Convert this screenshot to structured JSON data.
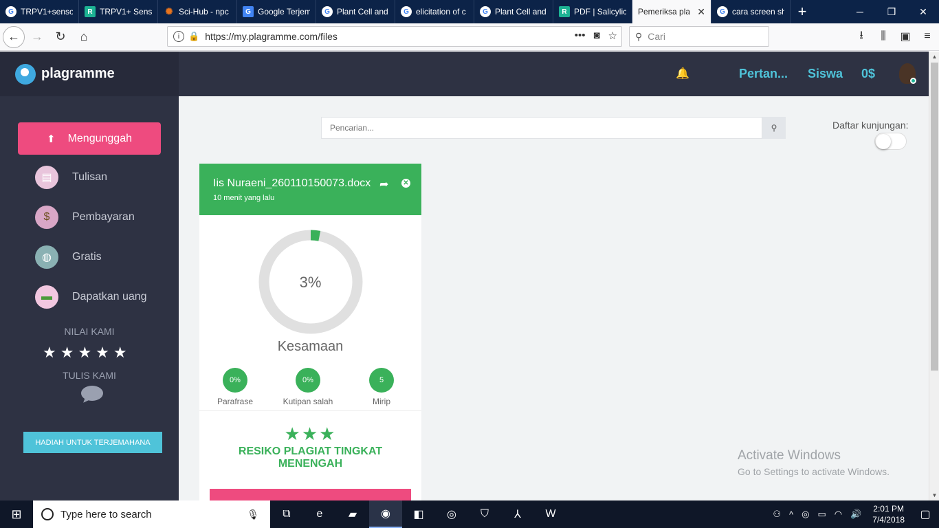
{
  "browser": {
    "tabs": [
      {
        "label": "TRPV1+senso",
        "favicon": "google"
      },
      {
        "label": "TRPV1+ Sens",
        "favicon": "researchgate"
      },
      {
        "label": "Sci-Hub - npc",
        "favicon": "scihub"
      },
      {
        "label": "Google Terjem",
        "favicon": "google-translate"
      },
      {
        "label": "Plant Cell and",
        "favicon": "google"
      },
      {
        "label": "elicitation of c",
        "favicon": "google"
      },
      {
        "label": "Plant Cell and",
        "favicon": "google"
      },
      {
        "label": "PDF | Salicylic",
        "favicon": "researchgate"
      },
      {
        "label": "Pemeriksa pla",
        "favicon": "none",
        "active": true
      },
      {
        "label": "cara screen sh",
        "favicon": "google"
      }
    ],
    "url": "https://my.plagramme.com/files",
    "search_placeholder": "Cari"
  },
  "app": {
    "logo_text": "plagramme",
    "topbar": {
      "link1": "Pertan...",
      "link2": "Siswa",
      "balance": "0$"
    },
    "sidebar": {
      "upload_label": "Mengunggah",
      "items": [
        {
          "label": "Tulisan",
          "icon": "document-icon"
        },
        {
          "label": "Pembayaran",
          "icon": "money-bag-icon"
        },
        {
          "label": "Gratis",
          "icon": "globe-dollar-icon"
        },
        {
          "label": "Dapatkan uang",
          "icon": "cash-icon"
        }
      ],
      "rate_title": "NILAI KAMI",
      "rating_stars": 5,
      "write_title": "TULIS KAMI",
      "reward_label": "HADIAH UNTUK TERJEMAHANA"
    },
    "search": {
      "placeholder": "Pencarian..."
    },
    "visits_label": "Daftar kunjungan:",
    "card": {
      "title": "Iis Nuraeni_260110150073.docx",
      "time": "10 menit yang lalu",
      "percent_text": "3%",
      "percent_value": 3,
      "similarity_label": "Kesamaan",
      "metrics": [
        {
          "value": "0%",
          "label": "Parafrase"
        },
        {
          "value": "0%",
          "label": "Kutipan salah"
        },
        {
          "value": "5",
          "label": "Mirip"
        }
      ],
      "risk_stars": 3,
      "risk_text": "RESIKO PLAGIAT TINGKAT MENENGAH",
      "accent_color": "#3ab15a"
    },
    "colors": {
      "pink": "#ee4b7f",
      "cyan": "#4fc3d9",
      "green": "#3ab15a",
      "sidebar_bg": "#2e3243"
    }
  },
  "watermark": {
    "title": "Activate Windows",
    "subtitle": "Go to Settings to activate Windows."
  },
  "taskbar": {
    "search_placeholder": "Type here to search",
    "time": "2:01 PM",
    "date": "7/4/2018"
  }
}
